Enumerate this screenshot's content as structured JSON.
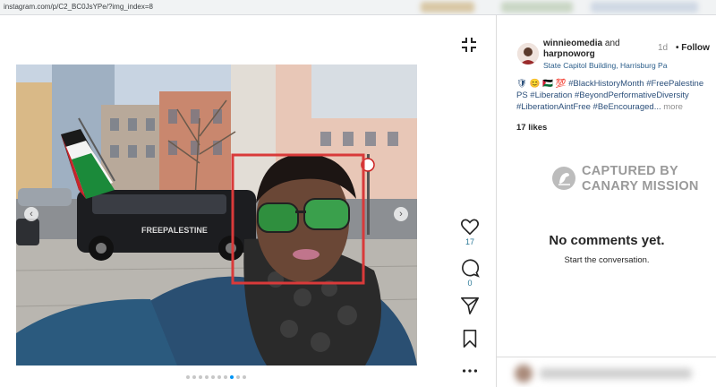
{
  "browser": {
    "url": "instagram.com/p/C2_BC0JsYPe/?img_index=8"
  },
  "post": {
    "author_primary": "winnieomedia",
    "and_text": "and",
    "author_secondary": "harpnoworg",
    "location": "State Capitol Building, Harrisburg Pa",
    "time_ago": "1d",
    "follow_label": "• Follow",
    "caption_line1": "🛡 😊 🇵🇸 💯 #BlackHistoryMonth #FreePalestine",
    "caption_line2": "PS #Liberation #BeyondPerformativeDiversity",
    "caption_line3": "#LiberationAintFree #BeEncouraged...",
    "caption_more": "more",
    "likes_text": "17 likes",
    "like_count": "17",
    "comment_count": "0",
    "car_text": "FREEPALESTINE",
    "carousel_total": 10,
    "carousel_active_index": 8
  },
  "watermark": {
    "line1": "CAPTURED BY",
    "line2": "CANARY MISSION"
  },
  "comments": {
    "empty_title": "No comments yet.",
    "empty_subtitle": "Start the conversation."
  },
  "icons": {
    "collapse": "collapse-icon",
    "heart": "heart-icon",
    "comment": "comment-icon",
    "share": "share-icon",
    "bookmark": "bookmark-icon",
    "more": "more-icon"
  },
  "colors": {
    "highlight_box": "#d93a3a",
    "active_dot": "#0095f6",
    "link_text": "#2b4f7a"
  }
}
